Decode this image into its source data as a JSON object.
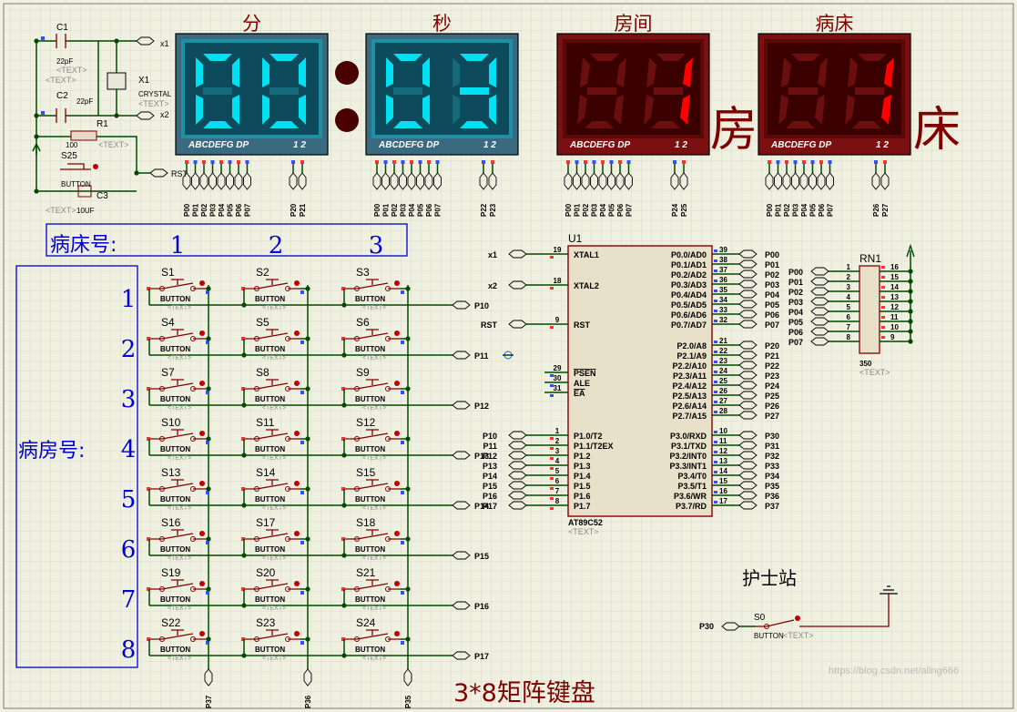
{
  "colors": {
    "background": "#f0f0e0",
    "grid": "#c8c8c0",
    "wire": "#004a00",
    "component": "#800000",
    "blue_label": "#0000cc",
    "seg_cyan": "#00e0f0",
    "seg_red": "#ff0000",
    "panel_teal": "#1f8fa3",
    "panel_red": "#8a1414",
    "watermark": "#bbbbbb"
  },
  "osc": {
    "c1": "C1",
    "c1v": "22pF",
    "c2": "C2",
    "c2v": "22pF",
    "x1": "X1",
    "x1v": "CRYSTAL",
    "r1": "R1",
    "r1v": "100",
    "s25": "S25",
    "s25v": "BUTTON",
    "c3": "C3",
    "c3v": "10UF",
    "net_x1": "x1",
    "net_x2": "x2",
    "net_rst": "RST",
    "text": "<TEXT>"
  },
  "displays": [
    {
      "title": "分",
      "digits": [
        "0",
        "0"
      ],
      "style": "cyan",
      "pins_a": [
        "P00",
        "P01",
        "P02",
        "P03",
        "P04",
        "P05",
        "P06",
        "P07"
      ],
      "pins_b": [
        "P20",
        "P21"
      ]
    },
    {
      "title": "秒",
      "digits": [
        "0",
        "3"
      ],
      "style": "cyan",
      "pins_a": [
        "P00",
        "P01",
        "P02",
        "P03",
        "P04",
        "P05",
        "P06",
        "P07"
      ],
      "pins_b": [
        "P22",
        "P23"
      ]
    },
    {
      "title": "房间",
      "digits": [
        "",
        "1"
      ],
      "style": "red",
      "pins_a": [
        "P00",
        "P01",
        "P02",
        "P03",
        "P04",
        "P05",
        "P06",
        "P07"
      ],
      "pins_b": [
        "P24",
        "P25"
      ]
    },
    {
      "title": "病床",
      "digits": [
        "",
        "1"
      ],
      "style": "red",
      "pins_a": [
        "P00",
        "P01",
        "P02",
        "P03",
        "P04",
        "P05",
        "P06",
        "P07"
      ],
      "pins_b": [
        "P26",
        "P27"
      ]
    }
  ],
  "seg_caption": "ABCDEFG  DP",
  "seg_caption2": "1 2",
  "big_chars": {
    "room": "房",
    "bed": "床"
  },
  "bed_header": {
    "label": "病床号:",
    "numbers": [
      "1",
      "2",
      "3"
    ]
  },
  "ward_header": {
    "label": "病房号:",
    "numbers": [
      "1",
      "2",
      "3",
      "4",
      "5",
      "6",
      "7",
      "8"
    ]
  },
  "keypad": {
    "buttons": [
      "S1",
      "S2",
      "S3",
      "S4",
      "S5",
      "S6",
      "S7",
      "S8",
      "S9",
      "S10",
      "S11",
      "S12",
      "S13",
      "S14",
      "S15",
      "S16",
      "S17",
      "S18",
      "S19",
      "S20",
      "S21",
      "S22",
      "S23",
      "S24"
    ],
    "button_type": "BUTTON",
    "rows": [
      "P10",
      "P11",
      "P12",
      "P13",
      "P14",
      "P15",
      "P16",
      "P17"
    ],
    "cols": [
      "P37",
      "P36",
      "P35"
    ],
    "title": "3*8矩阵键盘"
  },
  "mcu": {
    "ref": "U1",
    "name": "AT89C52",
    "text": "<TEXT>",
    "left_pins": [
      {
        "num": "19",
        "name": "XTAL1",
        "net": "x1"
      },
      {
        "num": "18",
        "name": "XTAL2",
        "net": "x2"
      },
      {
        "num": "9",
        "name": "RST",
        "net": "RST"
      },
      {
        "num": "29",
        "name": "PSEN",
        "net": ""
      },
      {
        "num": "30",
        "name": "ALE",
        "net": ""
      },
      {
        "num": "31",
        "name": "EA",
        "net": ""
      },
      {
        "num": "1",
        "name": "P1.0/T2",
        "net": "P10"
      },
      {
        "num": "2",
        "name": "P1.1/T2EX",
        "net": "P11"
      },
      {
        "num": "3",
        "name": "P1.2",
        "net": "P12"
      },
      {
        "num": "4",
        "name": "P1.3",
        "net": "P13"
      },
      {
        "num": "5",
        "name": "P1.4",
        "net": "P14"
      },
      {
        "num": "6",
        "name": "P1.5",
        "net": "P15"
      },
      {
        "num": "7",
        "name": "P1.6",
        "net": "P16"
      },
      {
        "num": "8",
        "name": "P1.7",
        "net": "P17"
      }
    ],
    "right_pins": [
      {
        "num": "39",
        "name": "P0.0/AD0",
        "net": "P00"
      },
      {
        "num": "38",
        "name": "P0.1/AD1",
        "net": "P01"
      },
      {
        "num": "37",
        "name": "P0.2/AD2",
        "net": "P02"
      },
      {
        "num": "36",
        "name": "P0.3/AD3",
        "net": "P03"
      },
      {
        "num": "35",
        "name": "P0.4/AD4",
        "net": "P04"
      },
      {
        "num": "34",
        "name": "P0.5/AD5",
        "net": "P05"
      },
      {
        "num": "33",
        "name": "P0.6/AD6",
        "net": "P06"
      },
      {
        "num": "32",
        "name": "P0.7/AD7",
        "net": "P07"
      },
      {
        "num": "21",
        "name": "P2.0/A8",
        "net": "P20"
      },
      {
        "num": "22",
        "name": "P2.1/A9",
        "net": "P21"
      },
      {
        "num": "23",
        "name": "P2.2/A10",
        "net": "P22"
      },
      {
        "num": "24",
        "name": "P2.3/A11",
        "net": "P23"
      },
      {
        "num": "25",
        "name": "P2.4/A12",
        "net": "P24"
      },
      {
        "num": "26",
        "name": "P2.5/A13",
        "net": "P25"
      },
      {
        "num": "27",
        "name": "P2.6/A14",
        "net": "P26"
      },
      {
        "num": "28",
        "name": "P2.7/A15",
        "net": "P27"
      },
      {
        "num": "10",
        "name": "P3.0/RXD",
        "net": "P30"
      },
      {
        "num": "11",
        "name": "P3.1/TXD",
        "net": "P31"
      },
      {
        "num": "12",
        "name": "P3.2/INT0",
        "net": "P32"
      },
      {
        "num": "13",
        "name": "P3.3/INT1",
        "net": "P33"
      },
      {
        "num": "14",
        "name": "P3.4/T0",
        "net": "P34"
      },
      {
        "num": "15",
        "name": "P3.5/T1",
        "net": "P35"
      },
      {
        "num": "16",
        "name": "P3.6/WR",
        "net": "P36"
      },
      {
        "num": "17",
        "name": "P3.7/RD",
        "net": "P37"
      }
    ]
  },
  "rn1": {
    "ref": "RN1",
    "value": "350",
    "text": "<TEXT>",
    "left_nets": [
      "P00",
      "P01",
      "P02",
      "P03",
      "P04",
      "P05",
      "P06",
      "P07"
    ],
    "left_nums": [
      "1",
      "2",
      "3",
      "4",
      "5",
      "6",
      "7",
      "8"
    ],
    "right_nums": [
      "16",
      "15",
      "14",
      "13",
      "12",
      "11",
      "10",
      "9"
    ]
  },
  "nurse": {
    "title": "护士站",
    "button": "S0",
    "button_type": "BUTTON",
    "net": "P30",
    "text": "<TEXT>"
  },
  "watermark": "https://blog.csdn.net/aling666"
}
